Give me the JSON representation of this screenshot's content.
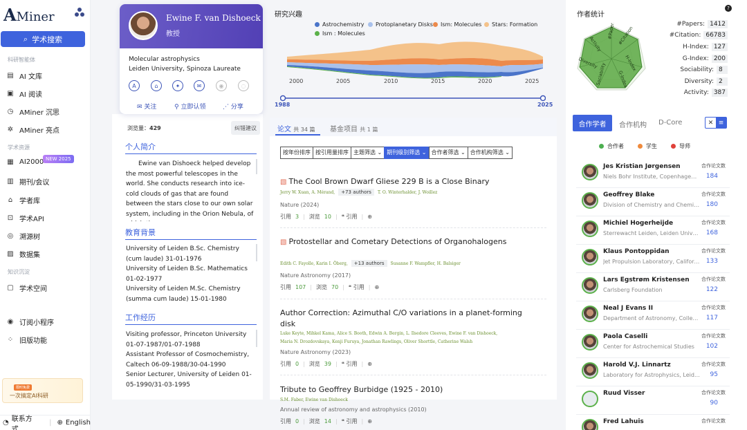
{
  "sidebar": {
    "logo_a": "A",
    "logo_text": "Miner",
    "search_label": "学术搜索",
    "section_agents": "科研智能体",
    "section_resources": "学术资源",
    "section_knowledge": "知识沉淀",
    "items": [
      {
        "label": "AI 文库",
        "icon": "book-icon"
      },
      {
        "label": "AI 阅读",
        "icon": "reading-icon"
      },
      {
        "label": "AMiner 沉思",
        "icon": "think-icon"
      },
      {
        "label": "AMiner 亮点",
        "icon": "highlight-icon"
      },
      {
        "label": "AI2000",
        "icon": "ai2000-icon"
      },
      {
        "label": "期刊/会议",
        "icon": "journal-icon"
      },
      {
        "label": "学者库",
        "icon": "scholar-icon"
      },
      {
        "label": "学术API",
        "icon": "api-icon"
      },
      {
        "label": "溯源树",
        "icon": "tree-icon"
      },
      {
        "label": "数据集",
        "icon": "dataset-icon"
      },
      {
        "label": "学术空间",
        "icon": "space-icon"
      },
      {
        "label": "订阅小程序",
        "icon": "subscribe-icon"
      },
      {
        "label": "旧版功能",
        "icon": "legacy-icon"
      }
    ],
    "new_tag": "NEW 2025",
    "promo_tag": "限时免费",
    "promo_text": "一次搞定AI科研",
    "contact": "联系方式",
    "language": "English"
  },
  "profile": {
    "name": "Ewine F. van Dishoeck",
    "title": "教授",
    "line1": "Molecular astrophysics",
    "line2": "Leiden University, Spinoza Laureate",
    "follow": "关注",
    "claim": "立即认领",
    "share": "分享",
    "views_label": "浏览量：",
    "views": "429",
    "error_btn": "纠错建议",
    "bio_title": "个人简介",
    "bio": "Ewine van Dishoeck helped develop the most powerful telescopes in the world. She conducts research into ice-cold clouds of gas that are found between the stars close to our own solar system, including in the Orion Nebula, of which the",
    "edu_title": "教育背景",
    "edu": [
      "University of Leiden B.Sc. Chemistry (cum laude) 31-01-1976",
      "University of Leiden B.Sc. Mathematics 01-02-1977",
      "University of Leiden M.Sc. Chemistry (summa cum laude) 15-01-1980"
    ],
    "work_title": "工作经历",
    "work": [
      "Visiting professor, Princeton University 01-07-1987/01-07-1988",
      "Assistant Professor of Cosmochemistry, Caltech 06-09-1988/30-04-1990",
      "Senior Lecturer, University of Leiden 01-05-1990/31-03-1995"
    ]
  },
  "interests": {
    "title": "研究兴趣",
    "legend": [
      {
        "name": "Astrochemistry",
        "color": "#4a74c9"
      },
      {
        "name": "Protoplanetary Disks",
        "color": "#a9c1ec"
      },
      {
        "name": "Ism: Molecules",
        "color": "#ec8a4c"
      },
      {
        "name": "Stars: Formation",
        "color": "#f4c28a"
      },
      {
        "name": "Ism : Molecules",
        "color": "#5bb14a"
      }
    ],
    "years": [
      "2000",
      "2005",
      "2010",
      "2015",
      "2020",
      "2025"
    ],
    "range_start": "1988",
    "range_end": "2025"
  },
  "papers": {
    "tab_label": "论文",
    "tab_count": "共 34 篇",
    "proj_label": "基金项目",
    "proj_count": "共 1 篇",
    "filters": [
      "按年份排序",
      "按引用量排序",
      "主题筛选 ⌄",
      "期刊级别筛选 ⌄",
      "合作者筛选 ⌄",
      "合作机构筛选 ⌄"
    ],
    "cite_label": "引用",
    "view_label": "浏览",
    "quote_label": "引用",
    "items": [
      {
        "title": "The Cool Brown Dwarf Gliese 229 B is a Close Binary",
        "authors_a": "Jerry W. Xuan, A. Mérand,",
        "more": "+73 authors",
        "authors_b": "T. O. Winterhalder, J. Woillez",
        "venue": "Nature (2024)",
        "cites": "3",
        "views": "10"
      },
      {
        "title": "Protostellar and Cometary Detections of Organohalogens",
        "authors_a": "Edith C. Fayolle, Karin I. Öberg,",
        "more": "+13 authors",
        "authors_b": "Susanne F. Wampfler, H. Balsiger",
        "venue": "Nature Astronomy (2017)",
        "cites": "107",
        "views": "70"
      },
      {
        "title": "Author Correction: Azimuthal C/O variations in a planet-forming disk",
        "authors_a": "Luke Keyte, Mihkel Kama, Alice S. Booth, Edwin A. Bergin, L. Ilsedore Cleeves, Ewine F. van Dishoeck,",
        "authors_c": "Maria N. Drozdovskaya, Kenji Furuya, Jonathan Rawlings, Oliver Shorttle, Catherine Walsh",
        "venue": "Nature Astronomy (2023)",
        "cites": "0",
        "views": "39"
      },
      {
        "title": "Tribute to Geoffrey Burbidge (1925 - 2010)",
        "authors_a": "S.M. Faber, Ewine van Dishoeck",
        "venue": "Annual review of astronomy and astrophysics (2010)",
        "cites": "0",
        "views": "14"
      }
    ]
  },
  "stats": {
    "title": "作者统计",
    "help": "?",
    "radar_axes": [
      "#Papers",
      "#Citation",
      "H-Index",
      "G-Index",
      "Sociability",
      "Diversity",
      "Activity"
    ],
    "rows": [
      {
        "label": "#Papers:",
        "value": "1412"
      },
      {
        "label": "#Citation:",
        "value": "66783"
      },
      {
        "label": "H-Index:",
        "value": "127"
      },
      {
        "label": "G-Index:",
        "value": "200"
      },
      {
        "label": "Sociability:",
        "value": "8"
      },
      {
        "label": "Diversity:",
        "value": "2"
      },
      {
        "label": "Activity:",
        "value": "387"
      }
    ]
  },
  "coauthors": {
    "tabs": [
      "合作学者",
      "合作机构",
      "D-Core"
    ],
    "legend": [
      {
        "label": "合作者",
        "color": "#4caf50"
      },
      {
        "label": "学生",
        "color": "#ef8a3c"
      },
      {
        "label": "导师",
        "color": "#e0413a"
      }
    ],
    "count_label": "合作论文数",
    "items": [
      {
        "name": "Jes Kristian Jørgensen",
        "aff": "Niels Bohr Institute, Copenhagen University",
        "count": "184"
      },
      {
        "name": "Geoffrey Blake",
        "aff": "Division of Chemistry and Chemical Engineering",
        "count": "180"
      },
      {
        "name": "Michiel Hogerheijde",
        "aff": "Sterrewacht Leiden, Leiden University",
        "count": "168"
      },
      {
        "name": "Klaus Pontoppidan",
        "aff": "Jet Propulsion Laboratory, California",
        "count": "133"
      },
      {
        "name": "Lars Egstrøm Kristensen",
        "aff": "Carlsberg Foundation",
        "count": "122"
      },
      {
        "name": "Neal J Evans II",
        "aff": "Department of Astronomy, College of Natural Sciences",
        "count": "117"
      },
      {
        "name": "Paola Caselli",
        "aff": "Center for Astrochemical Studies",
        "count": "102"
      },
      {
        "name": "Harold V.J. Linnartz",
        "aff": "Laboratory for Astrophysics, Leiden",
        "count": "95"
      },
      {
        "name": "Ruud Visser",
        "aff": "",
        "count": "90"
      },
      {
        "name": "Fred Lahuis",
        "aff": "",
        "count": ""
      }
    ]
  }
}
